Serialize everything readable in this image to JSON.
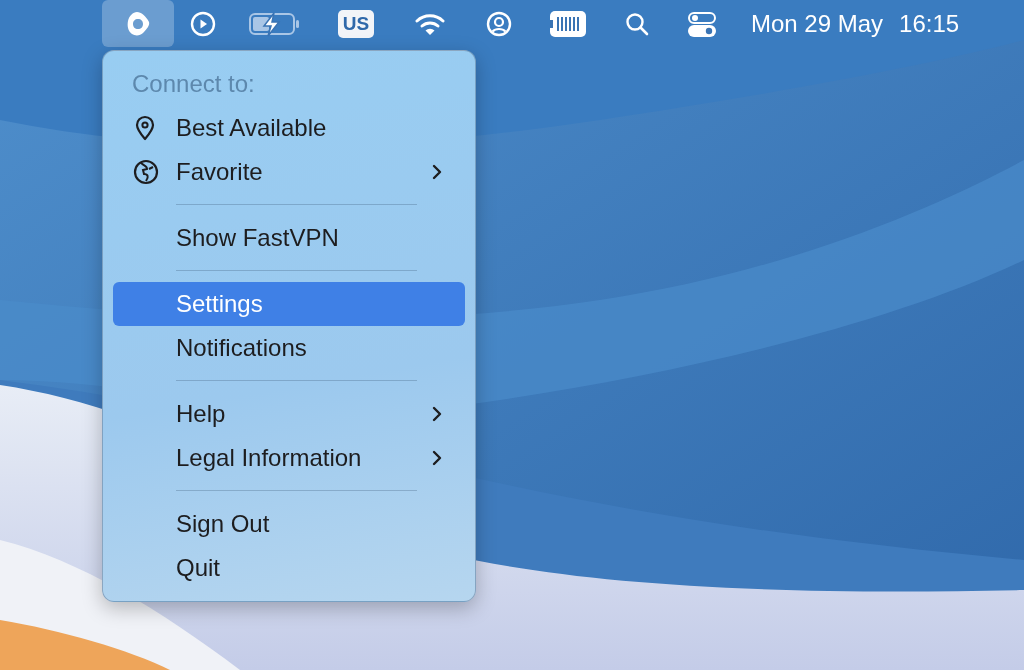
{
  "menu_bar": {
    "status_items": [
      {
        "kind": "app",
        "selected": true
      },
      {
        "kind": "play",
        "selected": false
      },
      {
        "kind": "battery",
        "selected": false
      },
      {
        "kind": "input",
        "text": "US",
        "selected": false
      },
      {
        "kind": "wifi",
        "selected": false
      },
      {
        "kind": "user",
        "selected": false
      },
      {
        "kind": "barcode",
        "selected": false
      },
      {
        "kind": "search",
        "selected": false
      },
      {
        "kind": "control",
        "selected": false
      }
    ],
    "date": "Mon 29 May",
    "time": "16:15"
  },
  "menu": {
    "items": [
      {
        "kind": "header",
        "label": "Connect to:"
      },
      {
        "kind": "location",
        "label": "Best Available",
        "submenu": false,
        "selected": false
      },
      {
        "kind": "favorite",
        "label": "Favorite",
        "submenu": true,
        "selected": false
      },
      {
        "kind": "separator"
      },
      {
        "kind": "item",
        "label": "Show FastVPN",
        "submenu": false,
        "selected": false
      },
      {
        "kind": "separator"
      },
      {
        "kind": "item",
        "label": "Settings",
        "submenu": false,
        "selected": true
      },
      {
        "kind": "item",
        "label": "Notifications",
        "submenu": false,
        "selected": false
      },
      {
        "kind": "separator"
      },
      {
        "kind": "item",
        "label": "Help",
        "submenu": true,
        "selected": false
      },
      {
        "kind": "item",
        "label": "Legal Information",
        "submenu": true,
        "selected": false
      },
      {
        "kind": "separator"
      },
      {
        "kind": "item",
        "label": "Sign Out",
        "submenu": false,
        "selected": false
      },
      {
        "kind": "item",
        "label": "Quit",
        "submenu": false,
        "selected": false
      }
    ]
  }
}
